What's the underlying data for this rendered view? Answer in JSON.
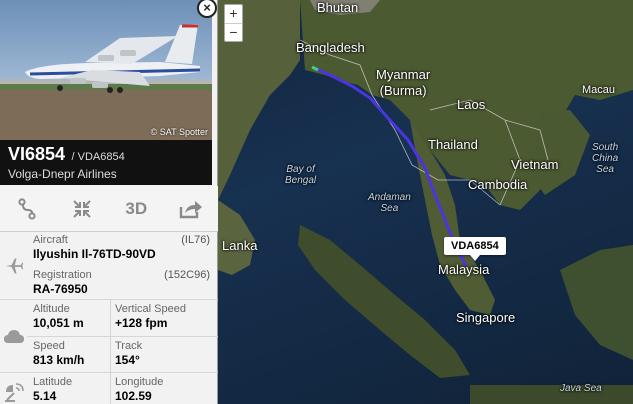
{
  "map": {
    "zoom_in": "+",
    "zoom_out": "−",
    "labels": {
      "bhutan": "Bhutan",
      "bangladesh": "Bangladesh",
      "myanmar": "Myanmar\n(Burma)",
      "laos": "Laos",
      "macau": "Macau",
      "bay_of_bengal": "Bay of\nBengal",
      "thailand": "Thailand",
      "vietnam": "Vietnam",
      "south_china_sea": "South\nChina\nSea",
      "cambodia": "Cambodia",
      "andaman_sea": "Andaman\nSea",
      "sri_lanka": "Lanka",
      "malaysia": "Malaysia",
      "singapore": "Singapore",
      "java_sea": "Java Sea"
    },
    "flight_tag": "VDA6854",
    "track_color": "#4a35e0",
    "track_start_color": "#3fd17a"
  },
  "panel": {
    "photo_credit": "© SAT Spotter",
    "close": "×",
    "callsign": "VI6854",
    "flight_code": "/ VDA6854",
    "airline": "Volga-Dnepr Airlines",
    "toolbar": {
      "route_icon": "route-icon",
      "collapse_icon": "collapse-icon",
      "view3d": "3D",
      "share_icon": "share-icon"
    },
    "aircraft": {
      "label": "Aircraft",
      "code": "(IL76)",
      "value": "Ilyushin Il-76TD-90VD"
    },
    "registration": {
      "label": "Registration",
      "code": "(152C96)",
      "value": "RA-76950"
    },
    "altitude": {
      "label": "Altitude",
      "value": "10,051 m"
    },
    "vertical_speed": {
      "label": "Vertical Speed",
      "value": "+128 fpm"
    },
    "speed": {
      "label": "Speed",
      "value": "813 km/h"
    },
    "track": {
      "label": "Track",
      "value": "154°"
    },
    "latitude": {
      "label": "Latitude",
      "value": "5.14"
    },
    "longitude": {
      "label": "Longitude",
      "value": "102.59"
    }
  }
}
